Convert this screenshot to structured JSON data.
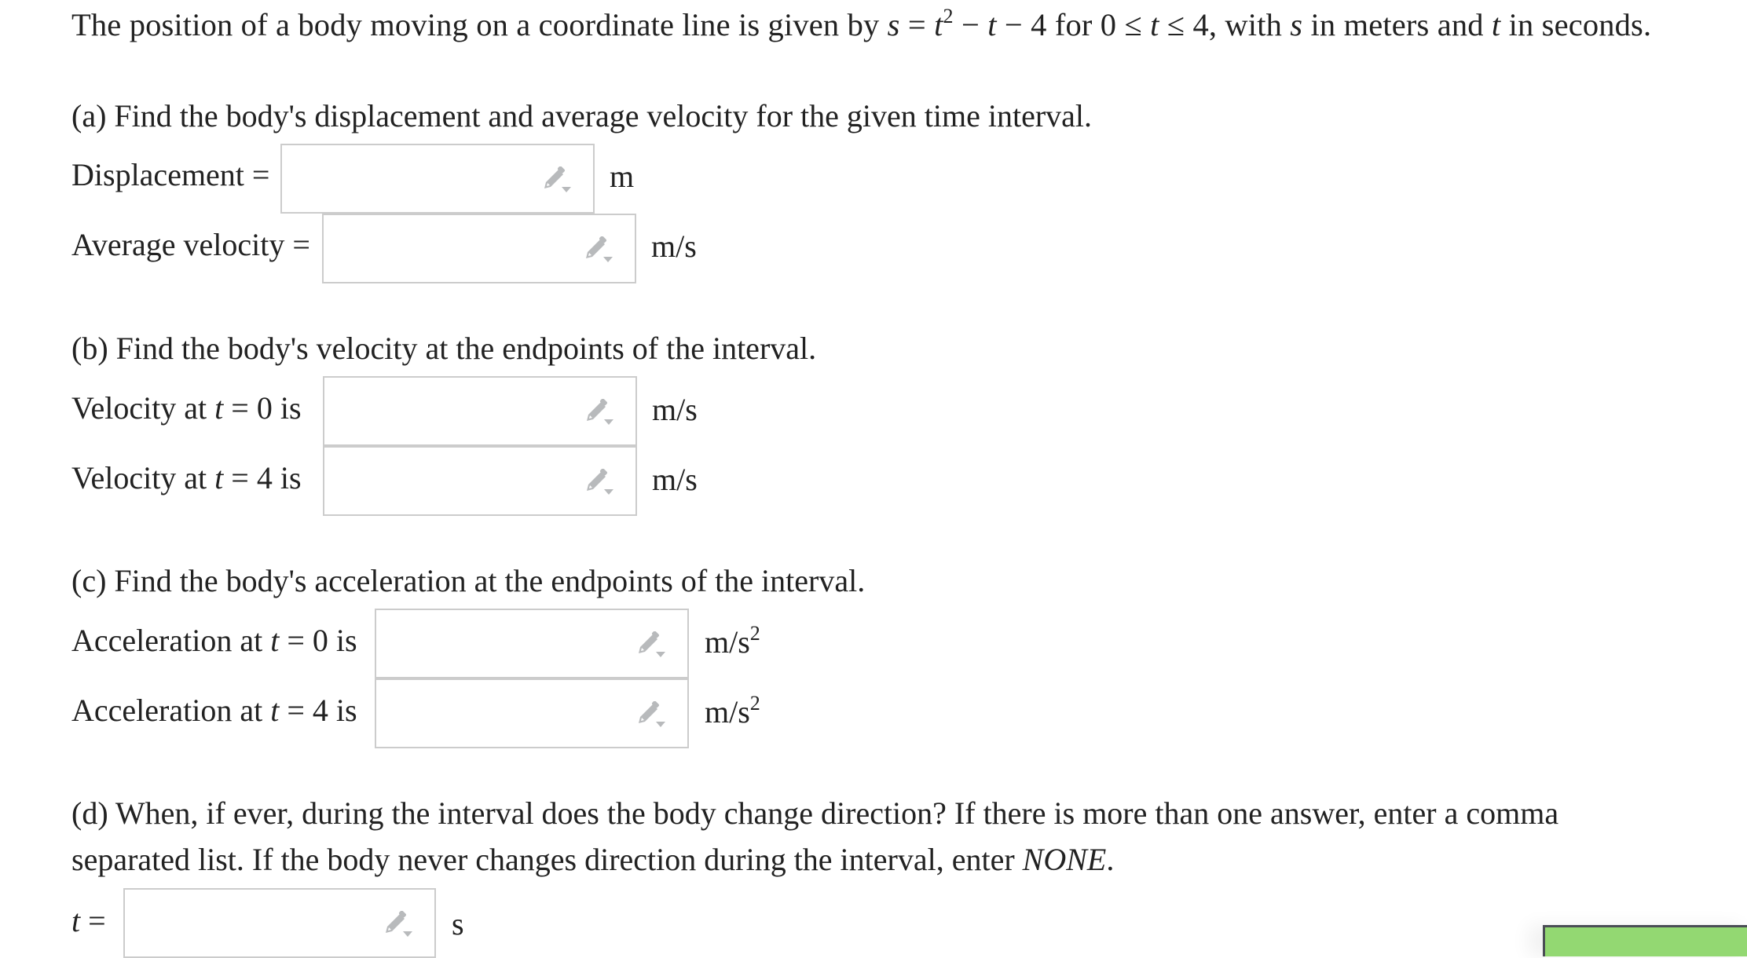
{
  "problem": {
    "intro_prefix": "The position of a body moving on a coordinate line is given by ",
    "formula_s": "s",
    "formula_eq": " = ",
    "formula_t": "t",
    "formula_exp": "2",
    "formula_rest_1": " − ",
    "formula_t2": "t",
    "formula_rest_2": " − 4 for 0 ≤ ",
    "formula_t3": "t",
    "formula_rest_3": " ≤ 4, with ",
    "formula_s2": "s",
    "formula_rest_4": " in meters and ",
    "formula_t4": "t",
    "formula_rest_5": " in seconds."
  },
  "parts": {
    "a": {
      "heading": "(a) Find the body's displacement and average velocity for the given time interval.",
      "rows": [
        {
          "label": "Displacement =",
          "value": "",
          "unit": "m"
        },
        {
          "label": "Average velocity =",
          "value": "",
          "unit": "m/s"
        }
      ]
    },
    "b": {
      "heading": "(b) Find the body's velocity at the endpoints of the interval.",
      "rows": [
        {
          "label_prefix": "Velocity at ",
          "var": "t",
          "label_suffix": " = 0 is",
          "value": "",
          "unit": "m/s"
        },
        {
          "label_prefix": "Velocity at ",
          "var": "t",
          "label_suffix": " = 4 is",
          "value": "",
          "unit": "m/s"
        }
      ]
    },
    "c": {
      "heading": "(c) Find the body's acceleration at the endpoints of the interval.",
      "rows": [
        {
          "label_prefix": "Acceleration at ",
          "var": "t",
          "label_suffix": " = 0 is",
          "value": "",
          "unit_base": "m/s",
          "unit_exp": "2"
        },
        {
          "label_prefix": "Acceleration at ",
          "var": "t",
          "label_suffix": " = 4 is",
          "value": "",
          "unit_base": "m/s",
          "unit_exp": "2"
        }
      ]
    },
    "d": {
      "heading_line1": "(d) When, if ever, during the interval does the body change direction? If there is more than one answer, enter a comma",
      "heading_line2_prefix": "separated list. If the body never changes direction during the interval, enter ",
      "heading_line2_emph": "NONE",
      "heading_line2_suffix": ".",
      "row": {
        "var": "t",
        "eq": " =",
        "value": "",
        "unit": "s"
      }
    }
  },
  "icons": {
    "pencil": "pencil-dropdown-icon"
  },
  "colors": {
    "text": "#222222",
    "box_border": "#cccccc",
    "icon_grey": "#b8babc",
    "button_green": "#93d872",
    "button_border": "#4a4d55"
  }
}
